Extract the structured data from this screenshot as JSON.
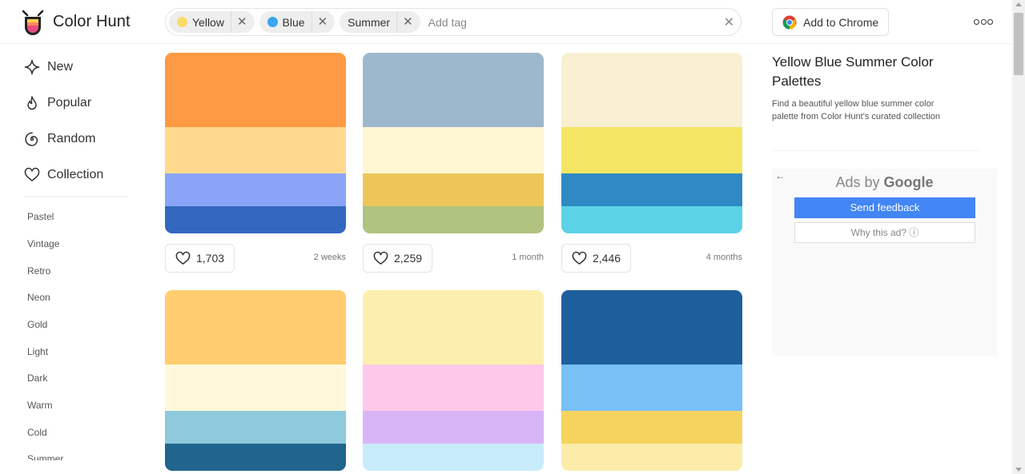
{
  "app": {
    "title": "Color Hunt"
  },
  "search": {
    "tags": [
      {
        "label": "Yellow",
        "dot_color": "#f9dc6b"
      },
      {
        "label": "Blue",
        "dot_color": "#3ba5f1"
      },
      {
        "label": "Summer",
        "dot_color": ""
      }
    ],
    "placeholder": "Add tag",
    "clear_glyph": "✕",
    "remove_glyph": "✕"
  },
  "header": {
    "chrome_label": "Add to Chrome"
  },
  "sidebar": {
    "nav": [
      "New",
      "Popular",
      "Random",
      "Collection"
    ],
    "tags": [
      "Pastel",
      "Vintage",
      "Retro",
      "Neon",
      "Gold",
      "Light",
      "Dark",
      "Warm",
      "Cold",
      "Summer"
    ]
  },
  "palettes": [
    {
      "colors": [
        "#ff9a44",
        "#ffda8e",
        "#8aa5f7",
        "#3468c0"
      ],
      "likes": "1,703",
      "time": "2 weeks"
    },
    {
      "colors": [
        "#9db8cd",
        "#fff6d3",
        "#ecc658",
        "#b1c380"
      ],
      "likes": "2,259",
      "time": "1 month"
    },
    {
      "colors": [
        "#f9efd1",
        "#f4e664",
        "#2f89c4",
        "#5bd2e6"
      ],
      "likes": "2,446",
      "time": "4 months"
    },
    {
      "colors": [
        "#ffcd70",
        "#fff8da",
        "#8ecadb",
        "#21648e"
      ],
      "likes": "",
      "time": ""
    },
    {
      "colors": [
        "#fcefae",
        "#fec8ea",
        "#d8b5f6",
        "#c8ecfc"
      ],
      "likes": "",
      "time": ""
    },
    {
      "colors": [
        "#1f5e9c",
        "#77c1f6",
        "#f6d35f",
        "#fbecaa"
      ],
      "likes": "",
      "time": ""
    }
  ],
  "info": {
    "title": "Yellow Blue Summer Color Palettes",
    "description": "Find a beautiful yellow blue summer color palette from Color Hunt's curated collection"
  },
  "ad": {
    "back_glyph": "←",
    "label_prefix": "Ads by",
    "label_brand": "Google",
    "feedback_label": "Send feedback",
    "why_label": "Why this ad? ⓘ"
  }
}
